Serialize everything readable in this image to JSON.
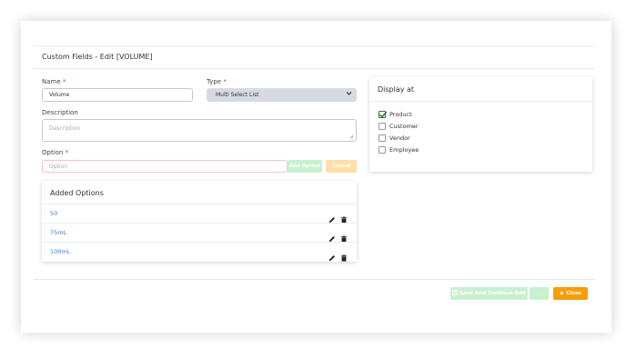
{
  "modal": {
    "title": "Custom Fields - Edit [VOLUME]"
  },
  "form": {
    "name_label": "Name",
    "name_value": "Volume",
    "type_label": "Type",
    "type_value": "Multi Select List",
    "required_mark": "*",
    "description_label": "Description",
    "description_placeholder": "Description",
    "option_label": "Option",
    "option_placeholder": "Option",
    "add_option_label": "Add Option",
    "cancel_label": "Cancel"
  },
  "added_options": {
    "heading": "Added Options",
    "items": [
      {
        "label": "50"
      },
      {
        "label": "75mL"
      },
      {
        "label": "100mL"
      }
    ]
  },
  "display_at": {
    "heading": "Display at",
    "items": [
      {
        "label": "Product",
        "checked": true
      },
      {
        "label": "Customer",
        "checked": false
      },
      {
        "label": "Vendor",
        "checked": false
      },
      {
        "label": "Employee",
        "checked": false
      }
    ]
  },
  "footer": {
    "save_continue_label": "Save And Continue Edit",
    "dropdown_label": "-",
    "close_label": "Close"
  },
  "colors": {
    "accent_green_disabled": "#c9f0cf",
    "accent_orange": "#f59e0b",
    "link_blue": "#3b82c4",
    "required_red": "#e53935"
  }
}
